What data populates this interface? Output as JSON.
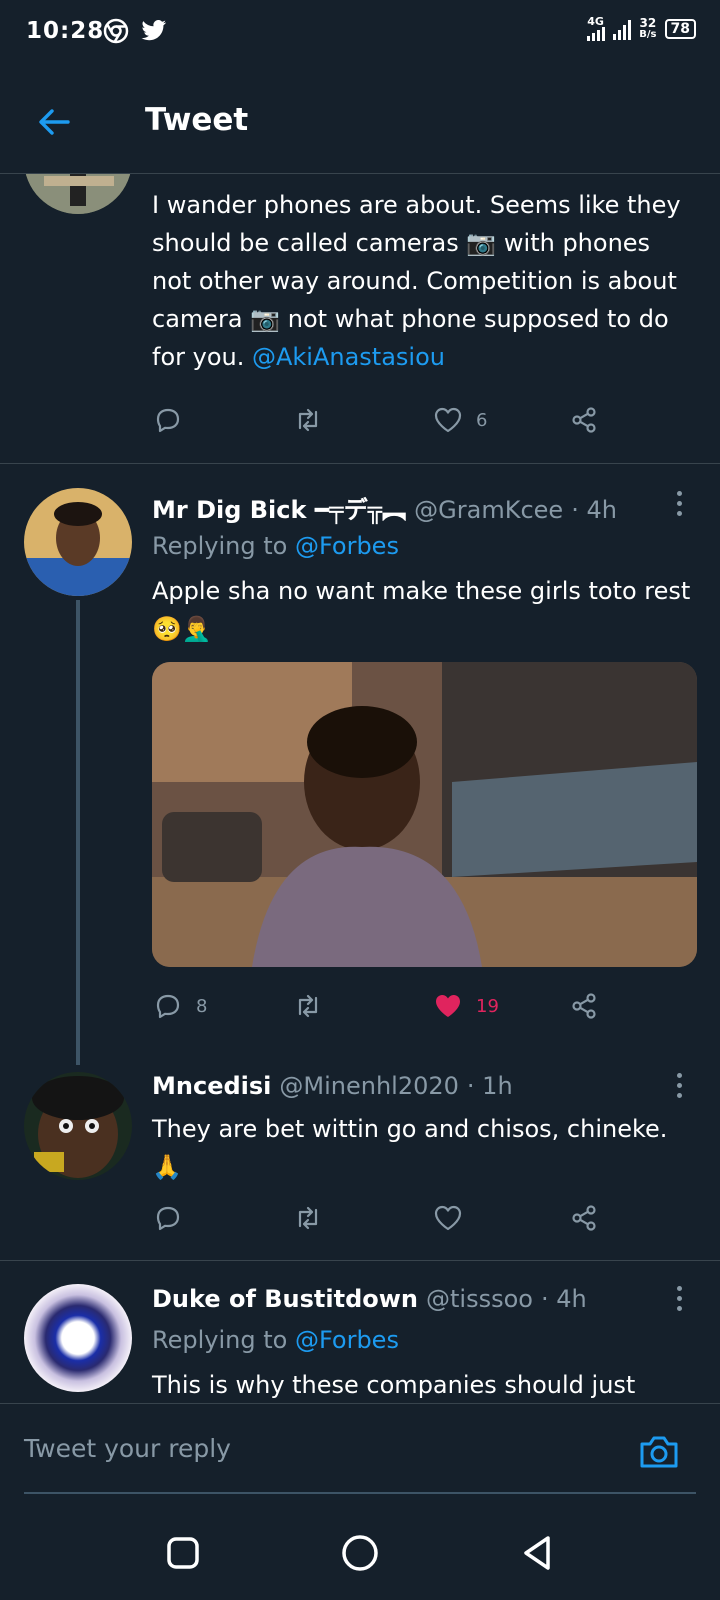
{
  "status_bar": {
    "time": "10:28",
    "network": "4G",
    "speed_value": "32",
    "speed_unit": "B/s",
    "battery": "78"
  },
  "header": {
    "title": "Tweet"
  },
  "tweets": [
    {
      "text_lines": [
        "I wander phones are about. Seems like they",
        "should be called cameras 📷 with phones",
        "not other way around. Competition is about",
        "camera 📷 not what phone supposed to do",
        "for you. "
      ],
      "mention": "@AkiAnastasiou",
      "likes": "6"
    },
    {
      "name": "Mr Dig Bick ━╤デ╦︻",
      "handle": "@GramKcee",
      "time": "· 4h",
      "replying_prefix": "Replying to ",
      "replying_to": "@Forbes",
      "text_line1": "Apple sha no want make these girls toto rest",
      "text_line2": "🥺🤦‍♂️",
      "replies": "8",
      "likes": "19"
    },
    {
      "name": "Mncedisi",
      "handle": "@Minenhl2020",
      "time": "· 1h",
      "text_line1": "They are bet wittin go and chisos, chineke.",
      "text_line2": "🙏"
    },
    {
      "name": "Duke of Bustitdown",
      "handle": "@tisssoo",
      "time": "· 4h",
      "replying_prefix": "Replying to ",
      "replying_to": "@Forbes",
      "text_line1": "This is why these companies should just"
    }
  ],
  "reply_bar": {
    "placeholder": "Tweet your reply"
  },
  "colors": {
    "background": "#15202b",
    "accent": "#1d9bf0",
    "like": "#e0245e",
    "muted": "#8899a6",
    "separator": "#38444d"
  },
  "icons": [
    "back-arrow-icon",
    "reply-icon",
    "retweet-icon",
    "heart-icon",
    "share-icon",
    "more-icon",
    "camera-icon",
    "chrome-icon",
    "twitter-icon"
  ]
}
